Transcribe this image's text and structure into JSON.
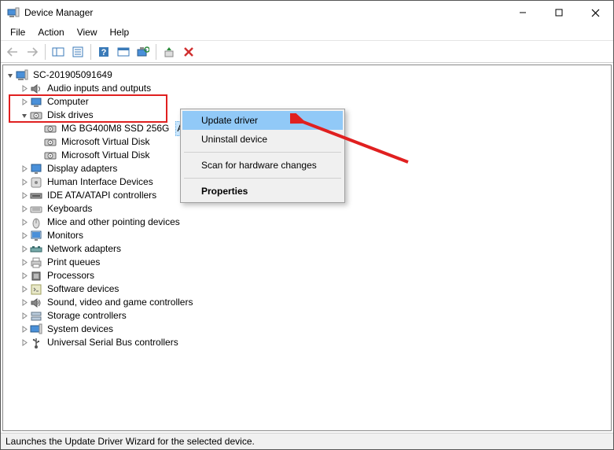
{
  "window": {
    "title": "Device Manager"
  },
  "menubar": {
    "items": [
      "File",
      "Action",
      "View",
      "Help"
    ]
  },
  "tree": {
    "root": "SC-201905091649",
    "categories": [
      {
        "label": "Audio inputs and outputs",
        "icon": "speaker"
      },
      {
        "label": "Computer",
        "icon": "computer"
      },
      {
        "label": "Disk drives",
        "icon": "disk",
        "expanded": true,
        "children": [
          {
            "label": "MG  BG400M8  SSD 256G",
            "icon": "disk",
            "selected_partial": true,
            "partial_tail": "ATA D"
          },
          {
            "label": "Microsoft Virtual Disk",
            "icon": "disk"
          },
          {
            "label": "Microsoft Virtual Disk",
            "icon": "disk"
          }
        ]
      },
      {
        "label": "Display adapters",
        "icon": "display"
      },
      {
        "label": "Human Interface Devices",
        "icon": "hid"
      },
      {
        "label": "IDE ATA/ATAPI controllers",
        "icon": "ide"
      },
      {
        "label": "Keyboards",
        "icon": "keyboard"
      },
      {
        "label": "Mice and other pointing devices",
        "icon": "mouse"
      },
      {
        "label": "Monitors",
        "icon": "monitor"
      },
      {
        "label": "Network adapters",
        "icon": "network"
      },
      {
        "label": "Print queues",
        "icon": "printer"
      },
      {
        "label": "Processors",
        "icon": "cpu"
      },
      {
        "label": "Software devices",
        "icon": "software"
      },
      {
        "label": "Sound, video and game controllers",
        "icon": "sound"
      },
      {
        "label": "Storage controllers",
        "icon": "storage"
      },
      {
        "label": "System devices",
        "icon": "system"
      },
      {
        "label": "Universal Serial Bus controllers",
        "icon": "usb"
      }
    ]
  },
  "context_menu": {
    "items": [
      {
        "label": "Update driver",
        "hover": true
      },
      {
        "label": "Uninstall device"
      },
      {
        "separator": true
      },
      {
        "label": "Scan for hardware changes"
      },
      {
        "separator": true
      },
      {
        "label": "Properties",
        "bold": true
      }
    ]
  },
  "statusbar": {
    "text": "Launches the Update Driver Wizard for the selected device."
  }
}
